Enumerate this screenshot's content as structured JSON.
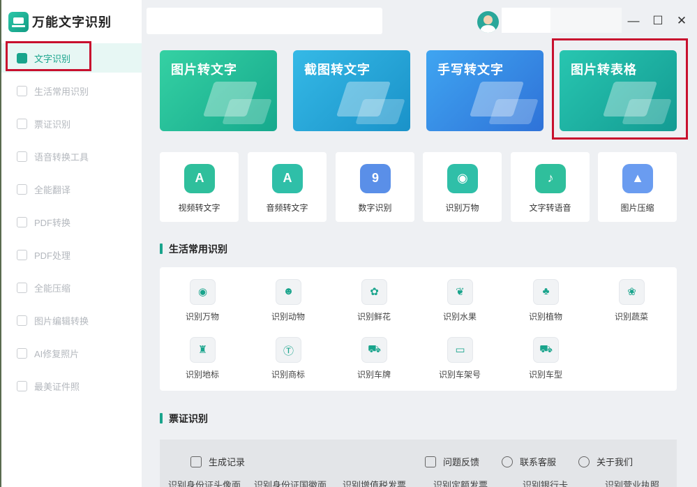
{
  "app": {
    "name": "万能文字识别"
  },
  "sidebar": {
    "items": [
      {
        "label": "文字识别",
        "icon": "text-scan-icon",
        "active": true
      },
      {
        "label": "生活常用识别",
        "icon": "life-icon"
      },
      {
        "label": "票证识别",
        "icon": "ticket-icon"
      },
      {
        "label": "语音转换工具",
        "icon": "voice-icon"
      },
      {
        "label": "全能翻译",
        "icon": "translate-icon"
      },
      {
        "label": "PDF转换",
        "icon": "pdf-convert-icon"
      },
      {
        "label": "PDF处理",
        "icon": "pdf-process-icon"
      },
      {
        "label": "全能压缩",
        "icon": "compress-icon"
      },
      {
        "label": "图片编辑转换",
        "icon": "image-edit-icon"
      },
      {
        "label": "AI修复照片",
        "icon": "ai-repair-icon"
      },
      {
        "label": "最美证件照",
        "icon": "id-photo-icon"
      }
    ]
  },
  "window": {
    "minimize": "—",
    "maximize": "☐",
    "close": "✕"
  },
  "feature_cards": [
    {
      "title": "图片转文字",
      "color": "#1fb997"
    },
    {
      "title": "截图转文字",
      "color": "#22a3d6"
    },
    {
      "title": "手写转文字",
      "color": "#3589e4"
    },
    {
      "title": "图片转表格",
      "color": "#1cafa0"
    }
  ],
  "tools": [
    {
      "label": "视频转文字",
      "glyph": "A",
      "color": "#2fbf9c"
    },
    {
      "label": "音频转文字",
      "glyph": "A",
      "color": "#2fbfa8"
    },
    {
      "label": "数字识别",
      "glyph": "9",
      "color": "#5a8fe8"
    },
    {
      "label": "识别万物",
      "glyph": "◉",
      "color": "#2fbfa8"
    },
    {
      "label": "文字转语音",
      "glyph": "♪",
      "color": "#2fbf9c"
    },
    {
      "label": "图片压缩",
      "glyph": "▲",
      "color": "#6a9cf0"
    }
  ],
  "sections": {
    "life": "生活常用识别",
    "ticket": "票证识别"
  },
  "life_items": [
    {
      "label": "识别万物",
      "glyph": "◉"
    },
    {
      "label": "识别动物",
      "glyph": "☻"
    },
    {
      "label": "识别鲜花",
      "glyph": "✿"
    },
    {
      "label": "识别水果",
      "glyph": "❦"
    },
    {
      "label": "识别植物",
      "glyph": "♣"
    },
    {
      "label": "识别蔬菜",
      "glyph": "❀"
    },
    {
      "label": "识别地标",
      "glyph": "♜"
    },
    {
      "label": "识别商标",
      "glyph": "Ⓣ"
    },
    {
      "label": "识别车牌",
      "glyph": "⛟"
    },
    {
      "label": "识别车架号",
      "glyph": "▭"
    },
    {
      "label": "识别车型",
      "glyph": "⛟"
    }
  ],
  "bottom_bar": {
    "history": "生成记录",
    "feedback": "问题反馈",
    "service": "联系客服",
    "about": "关于我们"
  },
  "ticket_items_cut": [
    "识别身份证头像面",
    "识别身份证国徽面",
    "识别增值税发票",
    "识别定额发票",
    "识别银行卡",
    "识别营业执照"
  ]
}
